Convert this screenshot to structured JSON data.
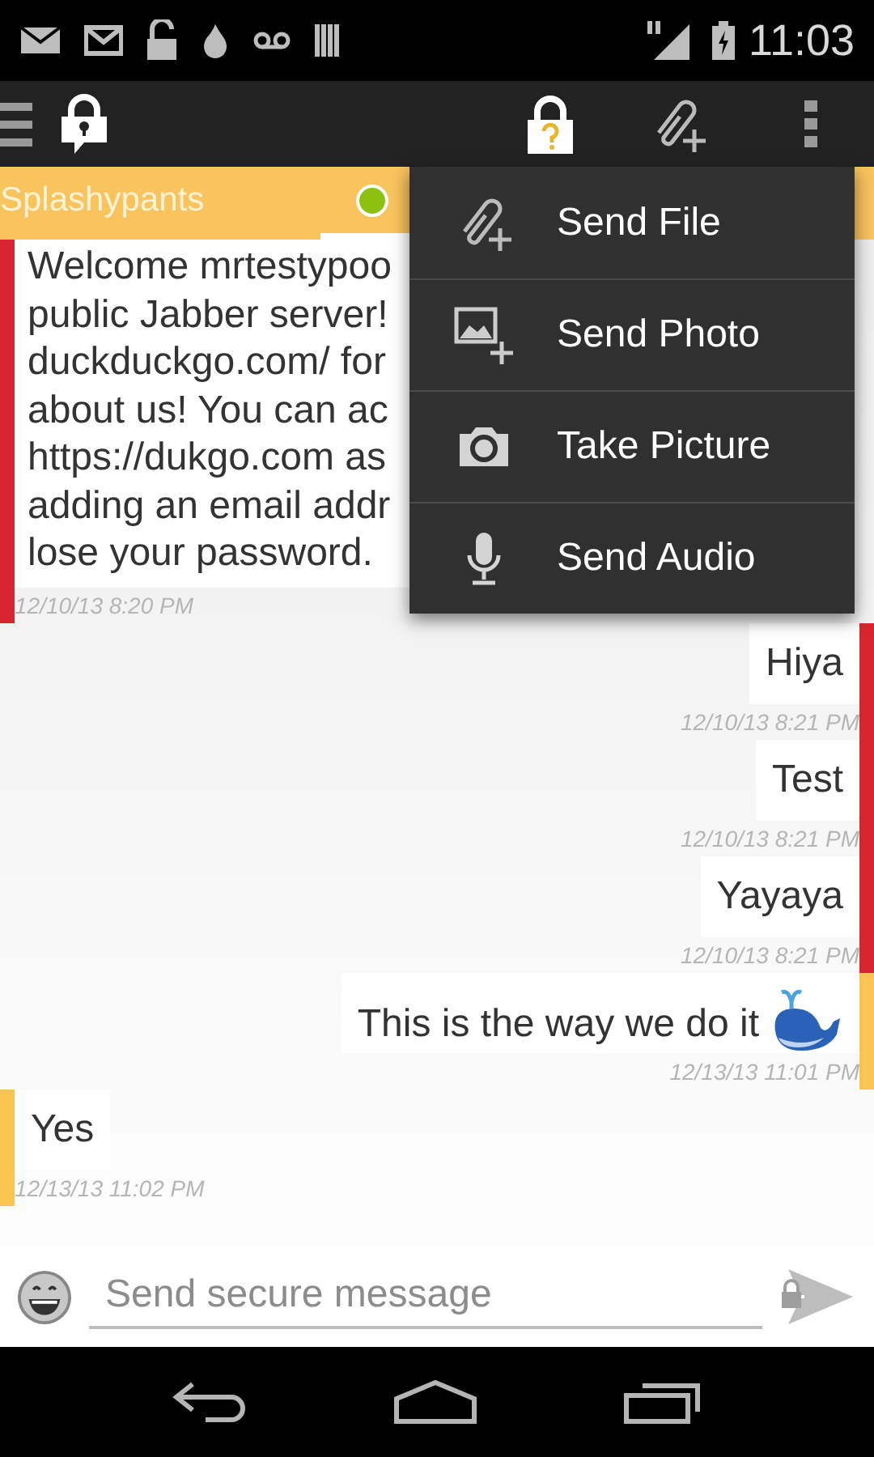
{
  "status_bar": {
    "time": "11:03"
  },
  "contact_tabs": [
    {
      "label": "Splashypants",
      "selected": false
    },
    {
      "selected": true,
      "color": "#8cc20f"
    }
  ],
  "menu": {
    "items": [
      {
        "label": "Send File",
        "kind": "file"
      },
      {
        "label": "Send Photo",
        "kind": "photo"
      },
      {
        "label": "Take Picture",
        "kind": "camera"
      },
      {
        "label": "Send Audio",
        "kind": "audio"
      }
    ]
  },
  "messages": [
    {
      "kind": "incoming",
      "color": "#d8262e",
      "lines": [
        "Welcome mrtestypoo",
        "public Jabber server!",
        "duckduckgo.com/ for",
        "about us! You can ac",
        "https://dukgo.com as",
        "adding an email addr",
        "lose your password."
      ],
      "time": "12/10/13 8:20 PM"
    },
    {
      "kind": "outgoing",
      "color": "#d8262e",
      "lines": [
        "Hiya"
      ],
      "time": "12/10/13 8:21 PM"
    },
    {
      "kind": "outgoing",
      "color": "#d8262e",
      "lines": [
        "Test"
      ],
      "time": "12/10/13 8:21 PM"
    },
    {
      "kind": "outgoing",
      "color": "#d8262e",
      "lines": [
        "Yayaya"
      ],
      "time": "12/10/13 8:21 PM"
    },
    {
      "kind": "outgoing",
      "color": "#f8c552",
      "lines": [
        "This is the way we do it"
      ],
      "emoji": true,
      "time": "12/13/13 11:01 PM"
    },
    {
      "kind": "incoming",
      "color": "#f8c552",
      "lines": [
        "Yes"
      ],
      "time": "12/13/13 11:02 PM"
    }
  ],
  "composer": {
    "placeholder": "Send secure message"
  }
}
